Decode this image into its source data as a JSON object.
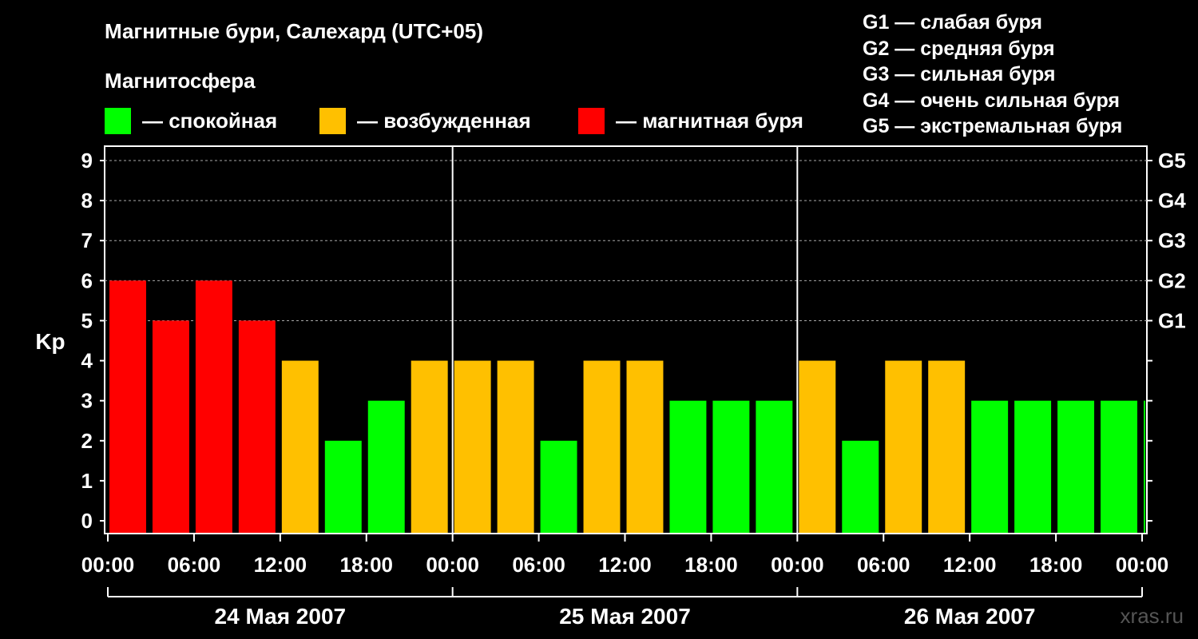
{
  "header": {
    "title": "Магнитные бури, Салехард (UTC+05)",
    "subtitle": "Магнитосфера"
  },
  "legend": [
    {
      "label": "— спокойная",
      "color": "#00ff00"
    },
    {
      "label": "— возбужденная",
      "color": "#ffc000"
    },
    {
      "label": "— магнитная буря",
      "color": "#ff0000"
    }
  ],
  "storm_scale": [
    "G1 — слабая буря",
    "G2 — средняя буря",
    "G3 — сильная буря",
    "G4 — очень сильная буря",
    "G5 — экстремальная буря"
  ],
  "watermark": "xras.ru",
  "chart_data": {
    "type": "bar",
    "ylabel": "Kp",
    "ylim": [
      0,
      9
    ],
    "y_ticks": [
      "0",
      "1",
      "2",
      "3",
      "4",
      "5",
      "6",
      "7",
      "8",
      "9"
    ],
    "right_ticks": [
      {
        "kp": 5,
        "label": "G1"
      },
      {
        "kp": 6,
        "label": "G2"
      },
      {
        "kp": 7,
        "label": "G3"
      },
      {
        "kp": 8,
        "label": "G4"
      },
      {
        "kp": 9,
        "label": "G5"
      }
    ],
    "x_ticks": [
      "00:00",
      "06:00",
      "12:00",
      "18:00",
      "00:00",
      "06:00",
      "12:00",
      "18:00",
      "00:00",
      "06:00",
      "12:00",
      "18:00",
      "00:00"
    ],
    "days": [
      "24 Мая 2007",
      "25 Мая 2007",
      "26 Мая 2007"
    ],
    "grid": true,
    "bar_interval_hours": 3,
    "values": [
      6,
      5,
      6,
      5,
      4,
      2,
      3,
      4,
      4,
      4,
      2,
      4,
      4,
      3,
      3,
      3,
      4,
      2,
      4,
      4,
      3,
      3,
      3,
      3,
      3
    ],
    "colors": {
      "quiet": "#00ff00",
      "unsettled": "#ffc000",
      "storm": "#ff0000"
    }
  }
}
